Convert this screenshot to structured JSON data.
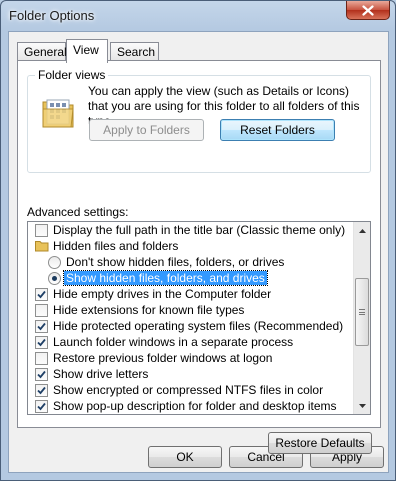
{
  "window": {
    "title": "Folder Options",
    "close_glyph": "✕"
  },
  "tabs": [
    {
      "label": "General",
      "active": false
    },
    {
      "label": "View",
      "active": true
    },
    {
      "label": "Search",
      "active": false
    }
  ],
  "folder_views": {
    "label": "Folder views",
    "description": "You can apply the view (such as Details or Icons) that you are using for this folder to all folders of this type.",
    "icon": "folder-view-icon",
    "apply_button": "Apply to Folders",
    "reset_button": "Reset Folders"
  },
  "advanced": {
    "label": "Advanced settings:",
    "items": [
      {
        "type": "checkbox",
        "label": "Display the full path in the title bar (Classic theme only)",
        "checked": false,
        "indent": 1
      },
      {
        "type": "folder",
        "label": "Hidden files and folders",
        "icon": "folder-icon",
        "indent": 1
      },
      {
        "type": "radio",
        "label": "Don't show hidden files, folders, or drives",
        "checked": false,
        "indent": 2
      },
      {
        "type": "radio",
        "label": "Show hidden files, folders, and drives",
        "checked": true,
        "selected": true,
        "indent": 2
      },
      {
        "type": "checkbox",
        "label": "Hide empty drives in the Computer folder",
        "checked": true,
        "indent": 1
      },
      {
        "type": "checkbox",
        "label": "Hide extensions for known file types",
        "checked": false,
        "indent": 1
      },
      {
        "type": "checkbox",
        "label": "Hide protected operating system files (Recommended)",
        "checked": true,
        "indent": 1
      },
      {
        "type": "checkbox",
        "label": "Launch folder windows in a separate process",
        "checked": true,
        "indent": 1
      },
      {
        "type": "checkbox",
        "label": "Restore previous folder windows at logon",
        "checked": false,
        "indent": 1
      },
      {
        "type": "checkbox",
        "label": "Show drive letters",
        "checked": true,
        "indent": 1
      },
      {
        "type": "checkbox",
        "label": "Show encrypted or compressed NTFS files in color",
        "checked": true,
        "indent": 1
      },
      {
        "type": "checkbox",
        "label": "Show pop-up description for folder and desktop items",
        "checked": true,
        "indent": 1
      }
    ]
  },
  "restore_defaults": "Restore Defaults",
  "footer": {
    "ok": "OK",
    "cancel": "Cancel",
    "apply": "Apply"
  }
}
